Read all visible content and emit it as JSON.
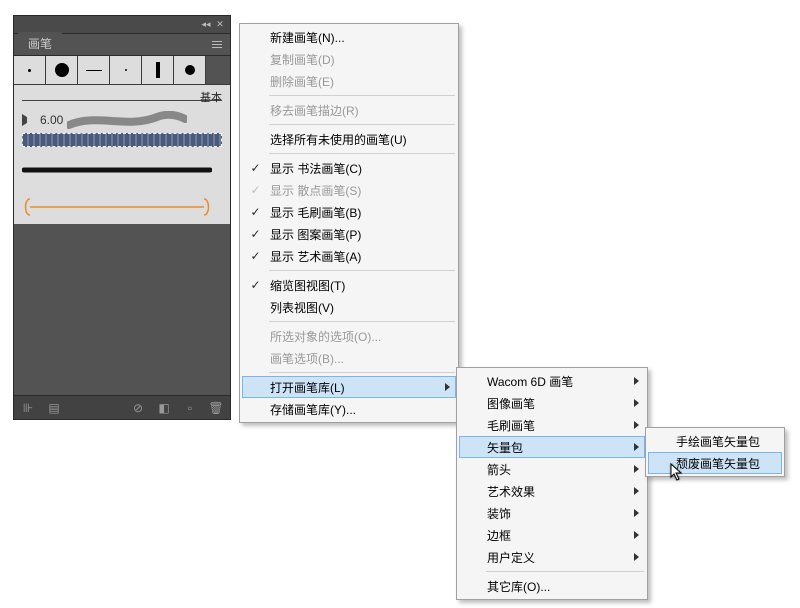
{
  "panel": {
    "tab_label": "画笔",
    "preview_label": "基本",
    "brush_val": "6.00",
    "brush_swatches": [
      {
        "type": "dot",
        "size": 3
      },
      {
        "type": "dot",
        "size": 14
      },
      {
        "type": "hline"
      },
      {
        "type": "dot",
        "size": 2
      },
      {
        "type": "bar"
      },
      {
        "type": "dot",
        "size": 10
      }
    ]
  },
  "main_menu": [
    {
      "label": "新建画笔(N)...",
      "type": "item"
    },
    {
      "label": "复制画笔(D)",
      "type": "item",
      "disabled": true
    },
    {
      "label": "删除画笔(E)",
      "type": "item",
      "disabled": true
    },
    {
      "type": "sep"
    },
    {
      "label": "移去画笔描边(R)",
      "type": "item",
      "disabled": true
    },
    {
      "type": "sep"
    },
    {
      "label": "选择所有未使用的画笔(U)",
      "type": "item"
    },
    {
      "type": "sep"
    },
    {
      "label": "显示 书法画笔(C)",
      "type": "item",
      "check": true
    },
    {
      "label": "显示 散点画笔(S)",
      "type": "item",
      "check": true,
      "checkoff": true,
      "disabled": true
    },
    {
      "label": "显示 毛刷画笔(B)",
      "type": "item",
      "check": true
    },
    {
      "label": "显示 图案画笔(P)",
      "type": "item",
      "check": true
    },
    {
      "label": "显示 艺术画笔(A)",
      "type": "item",
      "check": true
    },
    {
      "type": "sep"
    },
    {
      "label": "缩览图视图(T)",
      "type": "item",
      "check": true
    },
    {
      "label": "列表视图(V)",
      "type": "item"
    },
    {
      "type": "sep"
    },
    {
      "label": "所选对象的选项(O)...",
      "type": "item",
      "disabled": true
    },
    {
      "label": "画笔选项(B)...",
      "type": "item",
      "disabled": true
    },
    {
      "type": "sep"
    },
    {
      "label": "打开画笔库(L)",
      "type": "item",
      "sub": true,
      "highlight": true
    },
    {
      "label": "存储画笔库(Y)...",
      "type": "item"
    }
  ],
  "sub_menu_1": [
    {
      "label": "Wacom 6D 画笔",
      "sub": true
    },
    {
      "label": "图像画笔",
      "sub": true
    },
    {
      "label": "毛刷画笔",
      "sub": true
    },
    {
      "label": "矢量包",
      "sub": true,
      "highlight": true
    },
    {
      "label": "箭头",
      "sub": true
    },
    {
      "label": "艺术效果",
      "sub": true
    },
    {
      "label": "装饰",
      "sub": true
    },
    {
      "label": "边框",
      "sub": true
    },
    {
      "label": "用户定义",
      "sub": true
    },
    {
      "type": "sep"
    },
    {
      "label": "其它库(O)..."
    }
  ],
  "sub_menu_2": [
    {
      "label": "手绘画笔矢量包"
    },
    {
      "label": "颓废画笔矢量包",
      "highlight": true
    }
  ]
}
